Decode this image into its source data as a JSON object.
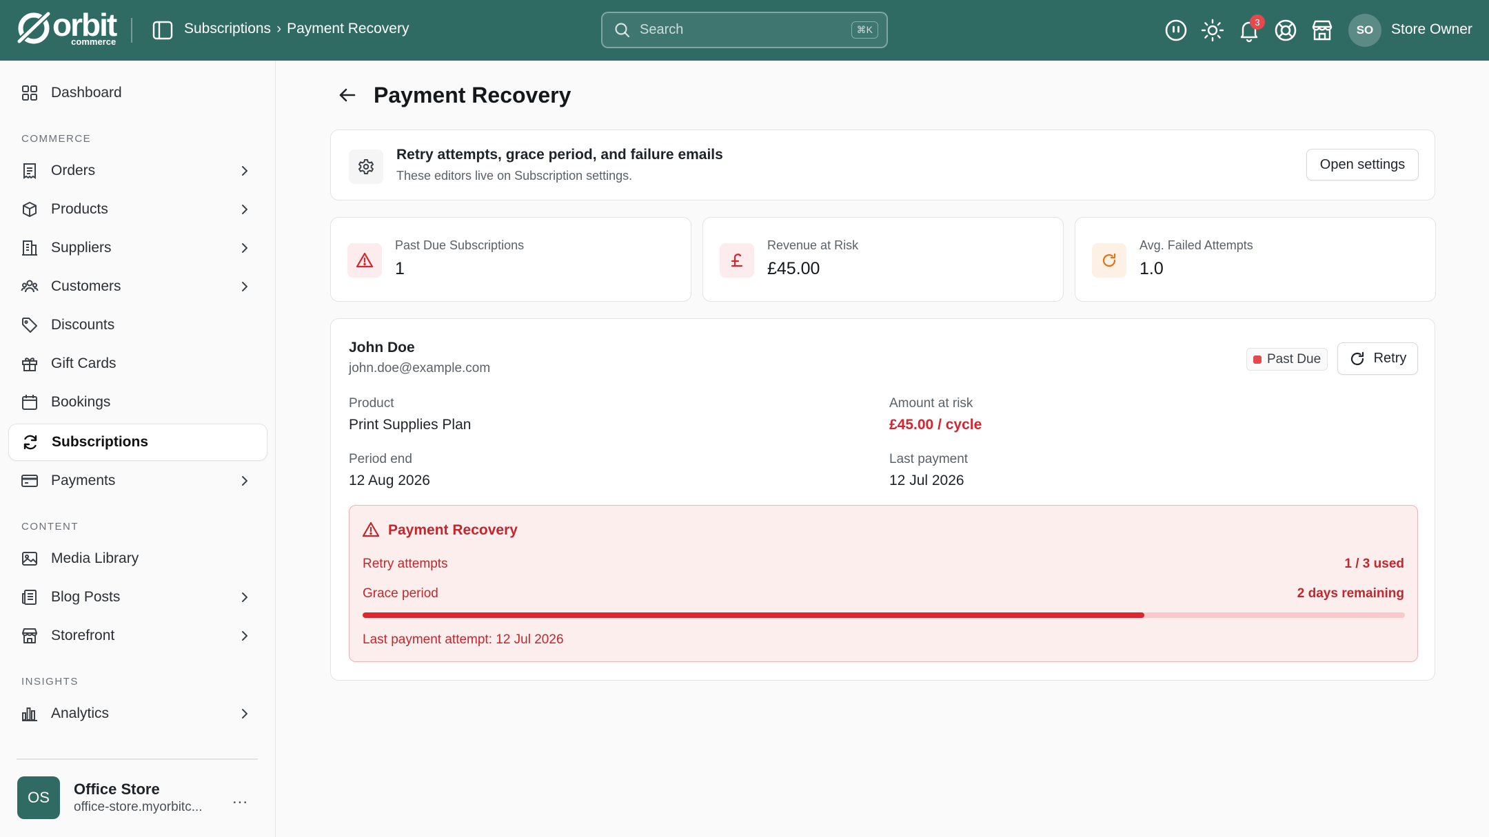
{
  "app": {
    "logo_word": "orbit",
    "logo_sub": "commerce",
    "breadcrumb": [
      "Subscriptions",
      "Payment Recovery"
    ],
    "breadcrumb_sep": "›",
    "search_placeholder": "Search",
    "search_shortcut": "⌘K",
    "notification_count": "3",
    "user_initials": "SO",
    "user_name": "Store Owner",
    "accent_color": "#2f6b63"
  },
  "sidebar": {
    "top_item": {
      "label": "Dashboard",
      "icon": "dashboard-icon"
    },
    "sections": [
      {
        "label": "COMMERCE",
        "items": [
          {
            "label": "Orders",
            "icon": "receipt-icon",
            "chevron": true
          },
          {
            "label": "Products",
            "icon": "box-icon",
            "chevron": true
          },
          {
            "label": "Suppliers",
            "icon": "building-icon",
            "chevron": true
          },
          {
            "label": "Customers",
            "icon": "users-icon",
            "chevron": true
          },
          {
            "label": "Discounts",
            "icon": "tag-icon",
            "chevron": false
          },
          {
            "label": "Gift Cards",
            "icon": "gift-icon",
            "chevron": false
          },
          {
            "label": "Bookings",
            "icon": "calendar-icon",
            "chevron": false
          },
          {
            "label": "Subscriptions",
            "icon": "refresh-icon",
            "chevron": false,
            "active": true
          },
          {
            "label": "Payments",
            "icon": "credit-card-icon",
            "chevron": true
          }
        ]
      },
      {
        "label": "CONTENT",
        "items": [
          {
            "label": "Media Library",
            "icon": "image-icon",
            "chevron": false
          },
          {
            "label": "Blog Posts",
            "icon": "newspaper-icon",
            "chevron": true
          },
          {
            "label": "Storefront",
            "icon": "store-icon",
            "chevron": true
          }
        ]
      },
      {
        "label": "INSIGHTS",
        "items": [
          {
            "label": "Analytics",
            "icon": "bar-chart-icon",
            "chevron": true
          }
        ]
      }
    ],
    "store": {
      "initials": "OS",
      "name": "Office Store",
      "url": "office-store.myorbitc...",
      "more": "..."
    }
  },
  "page": {
    "title": "Payment Recovery",
    "info": {
      "title": "Retry attempts, grace period, and failure emails",
      "subtitle": "These editors live on Subscription settings.",
      "button": "Open settings"
    },
    "stats": [
      {
        "label": "Past Due Subscriptions",
        "value": "1",
        "icon": "warning-icon",
        "icon_color": "#d3262e",
        "icon_bg": "#fdeced"
      },
      {
        "label": "Revenue at Risk",
        "value": "£45.00",
        "icon": "pound-icon",
        "icon_color": "#d3262e",
        "icon_bg": "#fdeced"
      },
      {
        "label": "Avg. Failed Attempts",
        "value": "1.0",
        "icon": "refresh-icon",
        "icon_color": "#e8730c",
        "icon_bg": "#fdf1e6"
      }
    ],
    "subscription": {
      "customer_name": "John Doe",
      "customer_email": "john.doe@example.com",
      "status": "Past Due",
      "retry_label": "Retry",
      "product_label": "Product",
      "product": "Print Supplies Plan",
      "amount_label": "Amount at risk",
      "amount": "£45.00 / cycle",
      "period_end_label": "Period end",
      "period_end": "12 Aug 2026",
      "last_payment_label": "Last payment",
      "last_payment": "12 Jul 2026",
      "recovery": {
        "title": "Payment Recovery",
        "retry_label": "Retry attempts",
        "retry_value": "1 / 3 used",
        "grace_label": "Grace period",
        "grace_value": "2 days remaining",
        "grace_progress": 0.75,
        "last_attempt": "Last payment attempt: 12 Jul 2026"
      }
    }
  }
}
